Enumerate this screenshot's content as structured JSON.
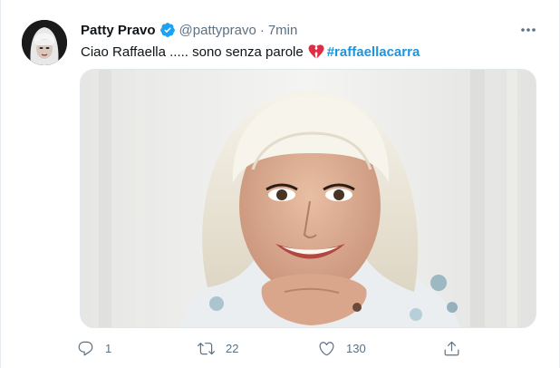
{
  "tweet": {
    "display_name": "Patty Pravo",
    "handle": "@pattypravo",
    "separator": "·",
    "time": "7min",
    "text": "Ciao Raffaella ..... sono senza parole",
    "hashtag": "#raffaellacarra",
    "verified": true,
    "icons": {
      "verified": "verified-badge-icon",
      "more": "more-options-icon",
      "emoji": "broken-heart-icon",
      "reply": "reply-icon",
      "retweet": "retweet-icon",
      "like": "like-icon",
      "share": "share-icon"
    }
  },
  "actions": {
    "reply_count": "1",
    "retweet_count": "22",
    "like_count": "130"
  },
  "colors": {
    "accent": "#1da1f2",
    "hashtag": "#1b95e0",
    "secondary_text": "#5b7083",
    "broken_heart": "#dd2e44"
  }
}
